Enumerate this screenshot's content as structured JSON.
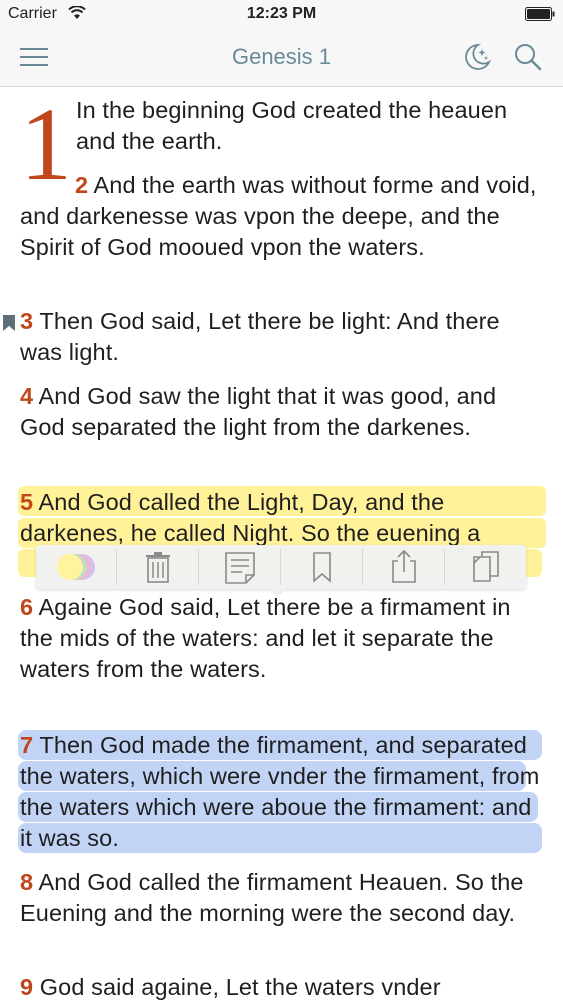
{
  "status_bar": {
    "carrier": "Carrier",
    "time": "12:23 PM"
  },
  "nav": {
    "title": "Genesis 1"
  },
  "chapter": {
    "drop_cap": "1"
  },
  "verses": [
    {
      "text": "In the beginning God created the heauen and the earth."
    },
    {
      "num": "2",
      "text": " And the earth was without forme and void, and darkenesse was vpon the deepe, and the Spirit of God mooued vpon the waters."
    },
    {
      "num": "3",
      "text": " Then God said, Let there be light: And there was light."
    },
    {
      "num": "4",
      "text": " And God saw the light that it was good, and God separated the light from the darkenes."
    },
    {
      "num": "5",
      "text": " And God called the Light, Day, and the darkenes, he called Night. So the euening a"
    },
    {
      "num": "6",
      "text": " Againe God said, Let there be a firmament in the mids of the waters: and let it separate the waters from the waters."
    },
    {
      "num": "7",
      "text": " Then God made the firmament, and separated the waters, which were vnder the firmament, from the waters which were aboue the firmament: and it was so."
    },
    {
      "num": "8",
      "text": " And God called the firmament Heauen. So the Euening and the morning were the second day."
    },
    {
      "num": "9",
      "text": " God said againe, Let the waters vnder"
    }
  ],
  "toolbar": {
    "actions": [
      "highlight-color",
      "delete",
      "note",
      "bookmark",
      "share",
      "copy"
    ]
  },
  "colors": {
    "accent": "#c0461c",
    "title": "#6a8a9a",
    "highlight_yellow": "#ffe846",
    "highlight_blue": "#78a0eb"
  }
}
